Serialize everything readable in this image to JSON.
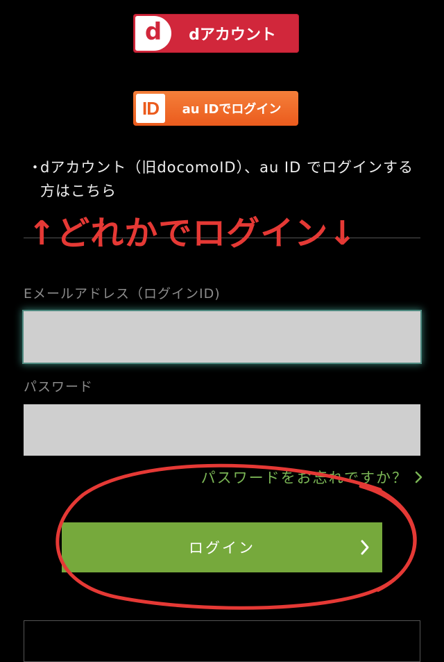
{
  "login_options": {
    "daccount": {
      "logo_letter": "d",
      "label": "dアカウント",
      "color": "#d1273b"
    },
    "auid": {
      "logo_text": "ID",
      "label": "au IDでログイン",
      "color": "#eb5b1d"
    }
  },
  "note": {
    "bullet": "・",
    "text": "dアカウント（旧docomoID）、au ID でログインする方はこちら"
  },
  "annotation": {
    "text": "↑どれかでログイン↓",
    "color": "#e53935"
  },
  "form": {
    "email_label": "Eメールアドレス（ログインID)",
    "email_value": "",
    "password_label": "パスワード",
    "password_value": "",
    "forgot_password": "パスワードをお忘れですか？",
    "login_button": "ログイン",
    "accent_color": "#76a93c"
  }
}
